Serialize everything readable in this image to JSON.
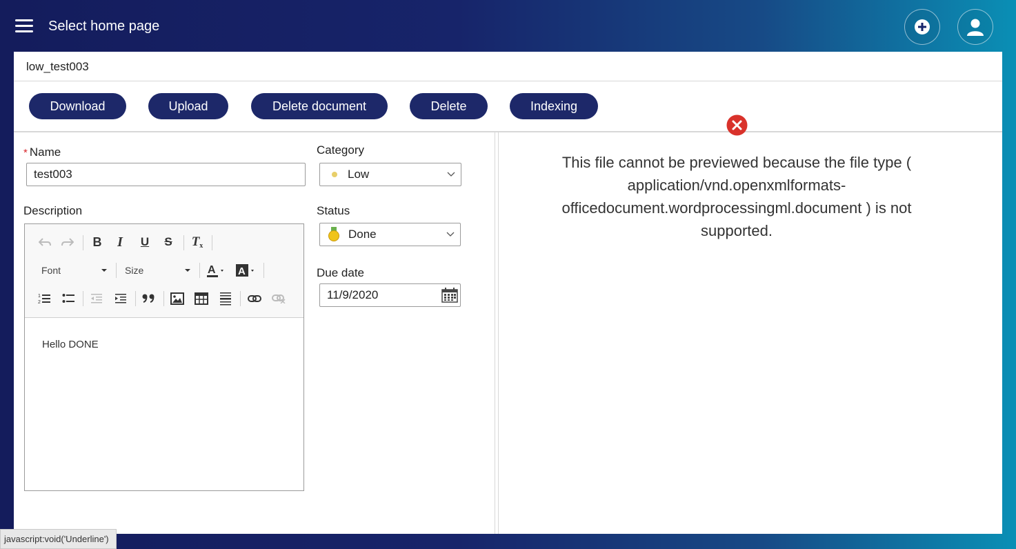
{
  "header": {
    "title": "Select home page",
    "menu_icon": "hamburger-menu-icon",
    "add_icon": "add-circle-icon",
    "user_icon": "user-icon"
  },
  "document": {
    "title": "low_test003"
  },
  "actions": [
    "Download",
    "Upload",
    "Delete document",
    "Delete",
    "Indexing"
  ],
  "form": {
    "name_label": "Name",
    "name_required_marker": "*",
    "name_value": "test003",
    "category_label": "Category",
    "category_value": "Low",
    "category_color": "#e8cf6a",
    "status_label": "Status",
    "status_value": "Done",
    "status_icon": "medal-icon",
    "due_date_label": "Due date",
    "due_date_value": "11/9/2020",
    "description_label": "Description"
  },
  "editor": {
    "font_label": "Font",
    "size_label": "Size",
    "content": "Hello DONE",
    "tools": [
      "undo",
      "redo",
      "bold",
      "italic",
      "underline",
      "strikethrough",
      "remove-format",
      "text-color",
      "background-color",
      "numbered-list",
      "bulleted-list",
      "decrease-indent",
      "increase-indent",
      "blockquote",
      "image",
      "table",
      "horizontal-line",
      "link",
      "unlink"
    ]
  },
  "preview": {
    "error_icon": "error-circle-icon",
    "error_color": "#d9322b",
    "message_lines": [
      "This file cannot be previewed because the file type (",
      "application/vnd.openxmlformats-",
      "officedocument.wordprocessingml.document ) is not",
      "supported."
    ]
  },
  "status_bar": {
    "text": "javascript:void('Underline')"
  },
  "colors": {
    "header_gradient_start": "#141c5c",
    "header_gradient_end": "#0a8fb5",
    "button_bg": "#1d2869"
  }
}
